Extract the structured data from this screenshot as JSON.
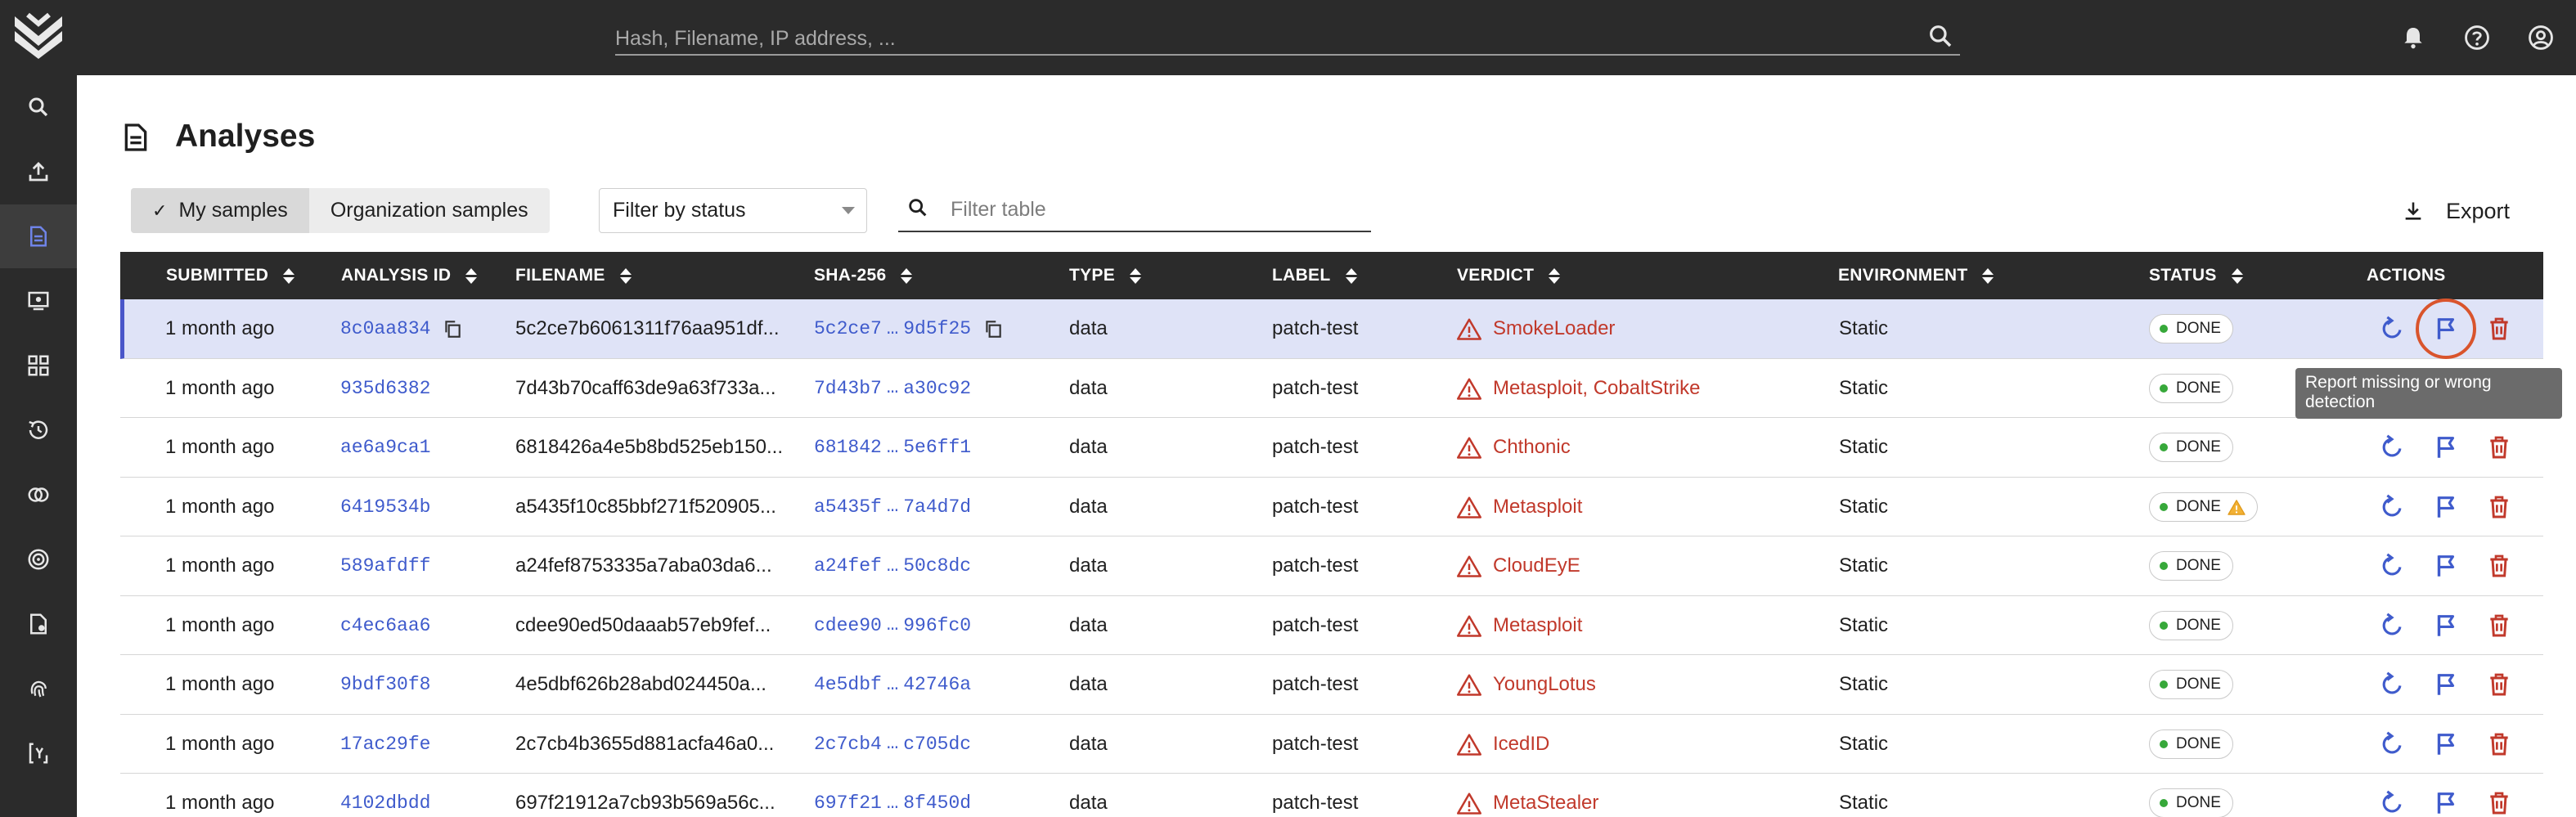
{
  "header": {
    "search_placeholder": "Hash, Filename, IP address, ..."
  },
  "page": {
    "title": "Analyses"
  },
  "toolbar": {
    "tabs": [
      {
        "label": "My samples",
        "active": true
      },
      {
        "label": "Organization samples",
        "active": false
      }
    ],
    "status_filter": "Filter by status",
    "filter_placeholder": "Filter table",
    "export_label": "Export"
  },
  "table": {
    "columns": [
      "SUBMITTED",
      "ANALYSIS ID",
      "FILENAME",
      "SHA-256",
      "TYPE",
      "LABEL",
      "VERDICT",
      "ENVIRONMENT",
      "STATUS",
      "ACTIONS"
    ],
    "rows": [
      {
        "submitted": "1 month ago",
        "analysis_id": "8c0aa834",
        "filename": "5c2ce7b6061311f76aa951df...",
        "sha_start": "5c2ce7",
        "sha_end": "9d5f25",
        "type": "data",
        "label": "patch-test",
        "verdict": "SmokeLoader",
        "environment": "Static",
        "status": "DONE",
        "selected": true
      },
      {
        "submitted": "1 month ago",
        "analysis_id": "935d6382",
        "filename": "7d43b70caff63de9a63f733a...",
        "sha_start": "7d43b7",
        "sha_end": "a30c92",
        "type": "data",
        "label": "patch-test",
        "verdict": "Metasploit, CobaltStrike",
        "environment": "Static",
        "status": "DONE"
      },
      {
        "submitted": "1 month ago",
        "analysis_id": "ae6a9ca1",
        "filename": "6818426a4e5b8bd525eb150...",
        "sha_start": "681842",
        "sha_end": "5e6ff1",
        "type": "data",
        "label": "patch-test",
        "verdict": "Chthonic",
        "environment": "Static",
        "status": "DONE"
      },
      {
        "submitted": "1 month ago",
        "analysis_id": "6419534b",
        "filename": "a5435f10c85bbf271f520905...",
        "sha_start": "a5435f",
        "sha_end": "7a4d7d",
        "type": "data",
        "label": "patch-test",
        "verdict": "Metasploit",
        "environment": "Static",
        "status": "DONE",
        "warning": true
      },
      {
        "submitted": "1 month ago",
        "analysis_id": "589afdff",
        "filename": "a24fef8753335a7aba03da6...",
        "sha_start": "a24fef",
        "sha_end": "50c8dc",
        "type": "data",
        "label": "patch-test",
        "verdict": "CloudEyE",
        "environment": "Static",
        "status": "DONE"
      },
      {
        "submitted": "1 month ago",
        "analysis_id": "c4ec6aa6",
        "filename": "cdee90ed50daaab57eb9fef...",
        "sha_start": "cdee90",
        "sha_end": "996fc0",
        "type": "data",
        "label": "patch-test",
        "verdict": "Metasploit",
        "environment": "Static",
        "status": "DONE"
      },
      {
        "submitted": "1 month ago",
        "analysis_id": "9bdf30f8",
        "filename": "4e5dbf626b28abd024450a...",
        "sha_start": "4e5dbf",
        "sha_end": "42746a",
        "type": "data",
        "label": "patch-test",
        "verdict": "YoungLotus",
        "environment": "Static",
        "status": "DONE"
      },
      {
        "submitted": "1 month ago",
        "analysis_id": "17ac29fe",
        "filename": "2c7cb4b3655d881acfa46a0...",
        "sha_start": "2c7cb4",
        "sha_end": "c705dc",
        "type": "data",
        "label": "patch-test",
        "verdict": "IcedID",
        "environment": "Static",
        "status": "DONE"
      },
      {
        "submitted": "1 month ago",
        "analysis_id": "4102dbdd",
        "filename": "697f21912a7cb93b569a56c...",
        "sha_start": "697f21",
        "sha_end": "8f450d",
        "type": "data",
        "label": "patch-test",
        "verdict": "MetaStealer",
        "environment": "Static",
        "status": "DONE"
      }
    ]
  },
  "tooltip": {
    "text": "Report missing or wrong detection"
  },
  "colors": {
    "accent": "#3f5bcc",
    "danger": "#c1392b",
    "success": "#37a83a",
    "chrome": "#2b2b2b"
  }
}
